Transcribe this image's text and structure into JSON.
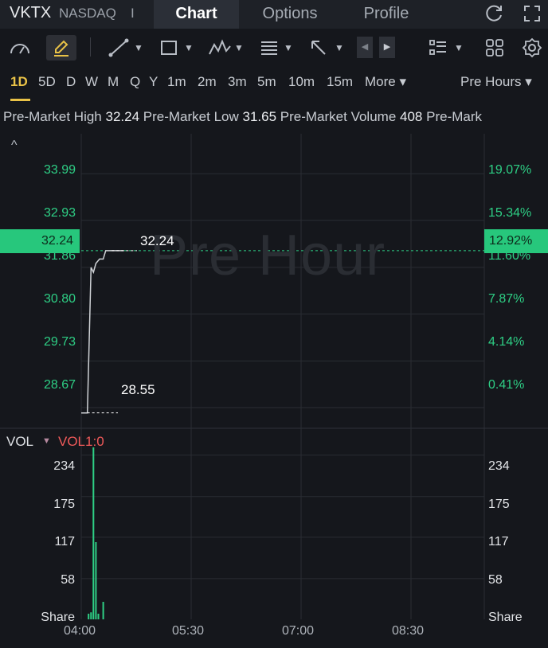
{
  "header": {
    "ticker": "VKTX",
    "exchange": "NASDAQ",
    "separator": "I",
    "tabs": [
      "Chart",
      "Options",
      "Profile"
    ],
    "active_tab": "Chart"
  },
  "periods": {
    "items": [
      "1D",
      "5D",
      "D",
      "W",
      "M",
      "Q",
      "Y",
      "1m",
      "2m",
      "3m",
      "5m",
      "10m",
      "15m"
    ],
    "more": "More ▾",
    "session": "Pre Hours ▾",
    "active": "1D"
  },
  "stats": {
    "high_label": "Pre-Market High",
    "high_value": "32.24",
    "low_label": "Pre-Market Low",
    "low_value": "31.65",
    "volume_label": "Pre-Market Volume",
    "volume_value": "408",
    "trailing": "Pre-Mark"
  },
  "price_chart": {
    "y_left": [
      "33.99",
      "32.93",
      "31.86",
      "30.80",
      "29.73",
      "28.67"
    ],
    "y_right": [
      "19.07%",
      "15.34%",
      "11.60%",
      "7.87%",
      "4.14%",
      "0.41%"
    ],
    "current_price": "32.24",
    "current_pct": "12.92%",
    "high_annotation": "32.24",
    "low_annotation": "28.55",
    "watermark": "Pre Hour",
    "collapse_glyph": "^"
  },
  "volume": {
    "title": "VOL",
    "indicator": "VOL1:0",
    "y_left": [
      "234",
      "175",
      "117",
      "58",
      "Share"
    ],
    "y_right": [
      "234",
      "175",
      "117",
      "58",
      "Share"
    ]
  },
  "x_axis": [
    "04:00",
    "05:30",
    "07:00",
    "08:30"
  ],
  "chart_data": {
    "type": "line",
    "price_series": {
      "x": [
        "04:00",
        "04:05",
        "04:08",
        "04:10",
        "04:12",
        "04:15",
        "04:18",
        "04:20",
        "04:25",
        "04:35"
      ],
      "y": [
        28.55,
        28.55,
        31.86,
        31.75,
        31.95,
        32.05,
        32.05,
        32.24,
        32.24,
        32.24
      ]
    },
    "volume_series": {
      "x": [
        "04:06",
        "04:08",
        "04:10",
        "04:12",
        "04:14",
        "04:18"
      ],
      "y": [
        8,
        10,
        245,
        110,
        8,
        25
      ]
    },
    "ylim_price": [
      28.2,
      34.9
    ],
    "ylim_volume": [
      0,
      270
    ],
    "colors": {
      "up": "#2ecf85",
      "line": "#cfd2d6",
      "grid": "#2a2d33",
      "accent": "#e9c247",
      "indicator": "#f05a5a"
    }
  }
}
